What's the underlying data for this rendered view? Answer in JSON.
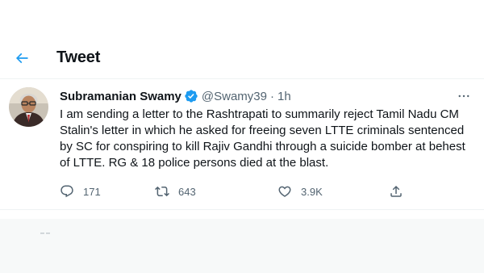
{
  "header": {
    "title": "Tweet",
    "back_icon": "arrow-left-icon"
  },
  "colors": {
    "accent": "#1d9bf0",
    "text_primary": "#0f1419",
    "text_secondary": "#536471",
    "divider": "#eff3f4",
    "band": "#f7f9f9"
  },
  "tweet": {
    "display_name": "Subramanian Swamy",
    "verified_icon": "verified-badge-icon",
    "handle": "@Swamy39",
    "separator": "·",
    "time": "1h",
    "more_icon": "more-horizontal-icon",
    "text": "I am sending a letter to the Rashtrapati to summarily reject Tamil Nadu CM Stalin's letter in which he asked for freeing seven LTTE criminals sentenced by SC for conspiring to kill Rajiv Gandhi through a suicide bomber at behest of LTTE. RG & 18 police persons died at the blast.",
    "actions": {
      "reply": {
        "icon": "reply-icon",
        "count": "171"
      },
      "retweet": {
        "icon": "retweet-icon",
        "count": "643"
      },
      "like": {
        "icon": "heart-icon",
        "count": "3.9K"
      },
      "share": {
        "icon": "share-icon"
      }
    }
  }
}
